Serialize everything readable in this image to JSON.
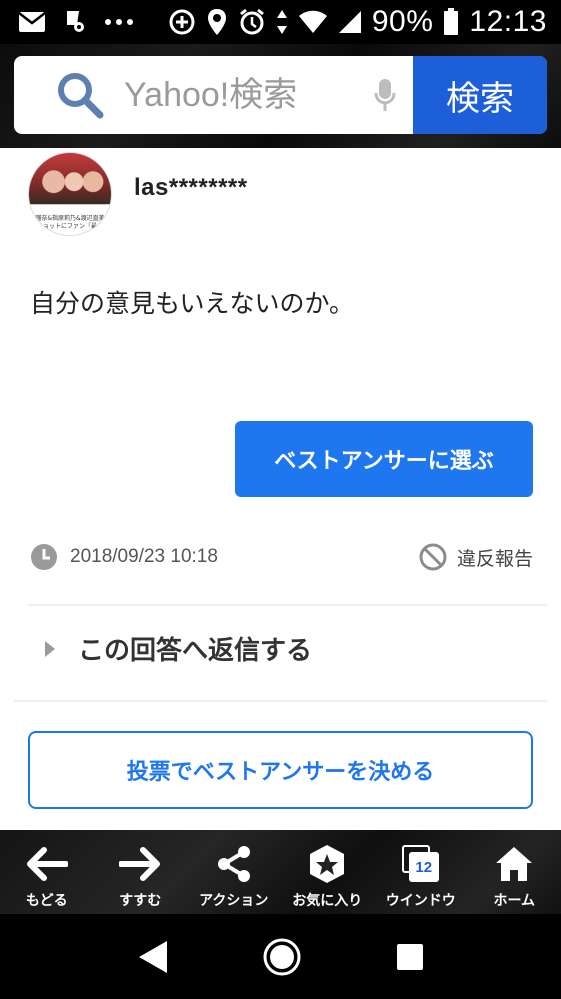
{
  "status_bar": {
    "battery": "90%",
    "time": "12:13",
    "left_icons": [
      "mail-icon",
      "location-pin-icon",
      "more-dots-icon"
    ],
    "right_icons": [
      "data-saver-icon",
      "location-icon",
      "alarm-icon",
      "data-arrows-icon",
      "wifi-icon",
      "signal-icon",
      "battery-icon"
    ]
  },
  "search": {
    "placeholder": "Yahoo!検索",
    "button_label": "検索"
  },
  "answer": {
    "username": "las********",
    "avatar_caption": "…瑠奈&指原莉乃&渡辺直美、ショットにファン「最…",
    "text": "自分の意見もいえないのか。",
    "best_answer_label": "ベストアンサーに選ぶ",
    "date": "2018/09/23 10:18",
    "report_label": "違反報告",
    "reply_label": "この回答へ返信する",
    "vote_label": "投票でベストアンサーを決める"
  },
  "toolbar": {
    "items": [
      {
        "label": "もどる",
        "icon": "arrow-left-icon"
      },
      {
        "label": "すすむ",
        "icon": "arrow-right-icon"
      },
      {
        "label": "アクション",
        "icon": "share-icon"
      },
      {
        "label": "お気に入り",
        "icon": "star-icon"
      },
      {
        "label": "ウインドウ",
        "icon": "window-icon",
        "count": "12"
      },
      {
        "label": "ホーム",
        "icon": "home-icon"
      }
    ]
  },
  "colors": {
    "accent": "#1f77f0",
    "search_button": "#1d5fd9"
  }
}
